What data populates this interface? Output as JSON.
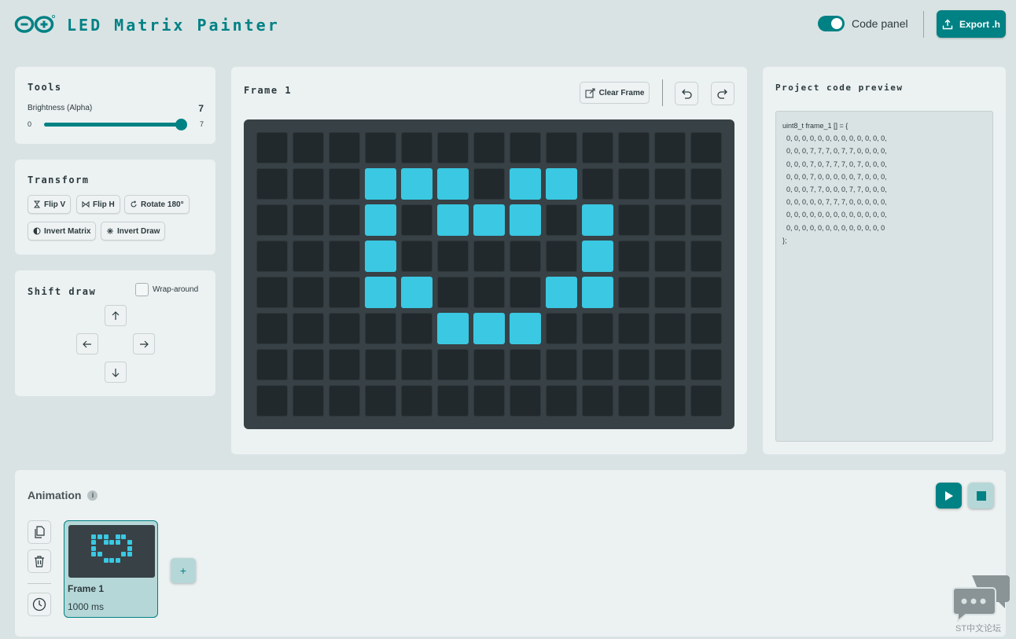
{
  "header": {
    "app_title": "LED Matrix Painter",
    "code_panel_label": "Code panel",
    "code_panel_on": true,
    "export_label": "Export .h"
  },
  "tools": {
    "title": "Tools",
    "brightness_label": "Brightness (Alpha)",
    "brightness_value": "7",
    "slider_min": "0",
    "slider_max": "7",
    "slider_fraction": 1.0
  },
  "transform": {
    "title": "Transform",
    "buttons": [
      "Flip V",
      "Flip H",
      "Rotate 180°",
      "Invert Matrix",
      "Invert Draw"
    ]
  },
  "shift": {
    "title": "Shift draw",
    "wrap_label": "Wrap-around",
    "wrap_checked": false
  },
  "editor": {
    "frame_title": "Frame 1",
    "clear_label": "Clear Frame",
    "matrix": [
      [
        0,
        0,
        0,
        0,
        0,
        0,
        0,
        0,
        0,
        0,
        0,
        0,
        0
      ],
      [
        0,
        0,
        0,
        7,
        7,
        7,
        0,
        7,
        7,
        0,
        0,
        0,
        0
      ],
      [
        0,
        0,
        0,
        7,
        0,
        7,
        7,
        7,
        0,
        7,
        0,
        0,
        0
      ],
      [
        0,
        0,
        0,
        7,
        0,
        0,
        0,
        0,
        0,
        7,
        0,
        0,
        0
      ],
      [
        0,
        0,
        0,
        7,
        7,
        0,
        0,
        0,
        7,
        7,
        0,
        0,
        0
      ],
      [
        0,
        0,
        0,
        0,
        0,
        7,
        7,
        7,
        0,
        0,
        0,
        0,
        0
      ],
      [
        0,
        0,
        0,
        0,
        0,
        0,
        0,
        0,
        0,
        0,
        0,
        0,
        0
      ],
      [
        0,
        0,
        0,
        0,
        0,
        0,
        0,
        0,
        0,
        0,
        0,
        0,
        0
      ]
    ],
    "led_on_color": "#3ac8e2",
    "led_off_color": "#22292d"
  },
  "code": {
    "title": "Project code preview",
    "text": "uint8_t frame_1 [] = {\n  0, 0, 0, 0, 0, 0, 0, 0, 0, 0, 0, 0, 0,\n  0, 0, 0, 7, 7, 7, 0, 7, 7, 0, 0, 0, 0,\n  0, 0, 0, 7, 0, 7, 7, 7, 0, 7, 0, 0, 0,\n  0, 0, 0, 7, 0, 0, 0, 0, 0, 7, 0, 0, 0,\n  0, 0, 0, 7, 7, 0, 0, 0, 7, 7, 0, 0, 0,\n  0, 0, 0, 0, 0, 7, 7, 7, 0, 0, 0, 0, 0,\n  0, 0, 0, 0, 0, 0, 0, 0, 0, 0, 0, 0, 0,\n  0, 0, 0, 0, 0, 0, 0, 0, 0, 0, 0, 0, 0\n};"
  },
  "animation": {
    "title": "Animation",
    "info_glyph": "i",
    "frames": [
      {
        "name": "Frame 1",
        "duration": "1000 ms"
      }
    ],
    "add_label": "+"
  },
  "watermark": {
    "text": "ST中文论坛"
  },
  "colors": {
    "accent": "#008184",
    "panel": "#ecf1f1",
    "background": "#dae3e4"
  }
}
